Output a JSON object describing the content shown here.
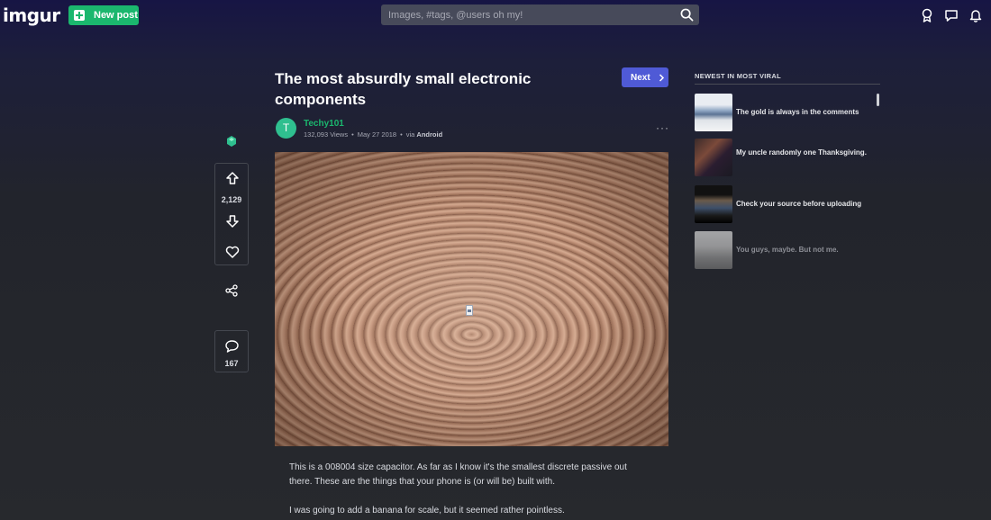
{
  "header": {
    "logo": "imgur",
    "new_post_label": "New post",
    "search_placeholder": "Images, #tags, @users oh my!",
    "icons": [
      "search-icon",
      "trophy-icon",
      "chat-icon",
      "bell-icon"
    ]
  },
  "post": {
    "title": "The most absurdly small electronic components",
    "next_label": "Next",
    "author_initial": "T",
    "author": "Techy101",
    "views": "132,093 Views",
    "date": "May 27 2018",
    "via_prefix": "via",
    "via": "Android",
    "more": "···",
    "votes": "2,129",
    "comments": "167",
    "description": [
      "This is a 008004 size capacitor. As far as I know it's the smallest discrete passive out there. These are the things that your phone is (or will be) built with.",
      "I was going to add a banana for scale, but it seemed rather pointless."
    ]
  },
  "sidebar": {
    "heading": "NEWEST IN MOST VIRAL",
    "items": [
      {
        "label": "The gold is always in the comments",
        "dim": false
      },
      {
        "label": "My uncle randomly one Thanksgiving.",
        "dim": false
      },
      {
        "label": "Check your source before uploading",
        "dim": false
      },
      {
        "label": "You guys, maybe. But not me.",
        "dim": true
      }
    ]
  },
  "colors": {
    "accent_green": "#1bb76e",
    "next_blue": "#4f5ad6",
    "search_bg": "#474a5a"
  }
}
